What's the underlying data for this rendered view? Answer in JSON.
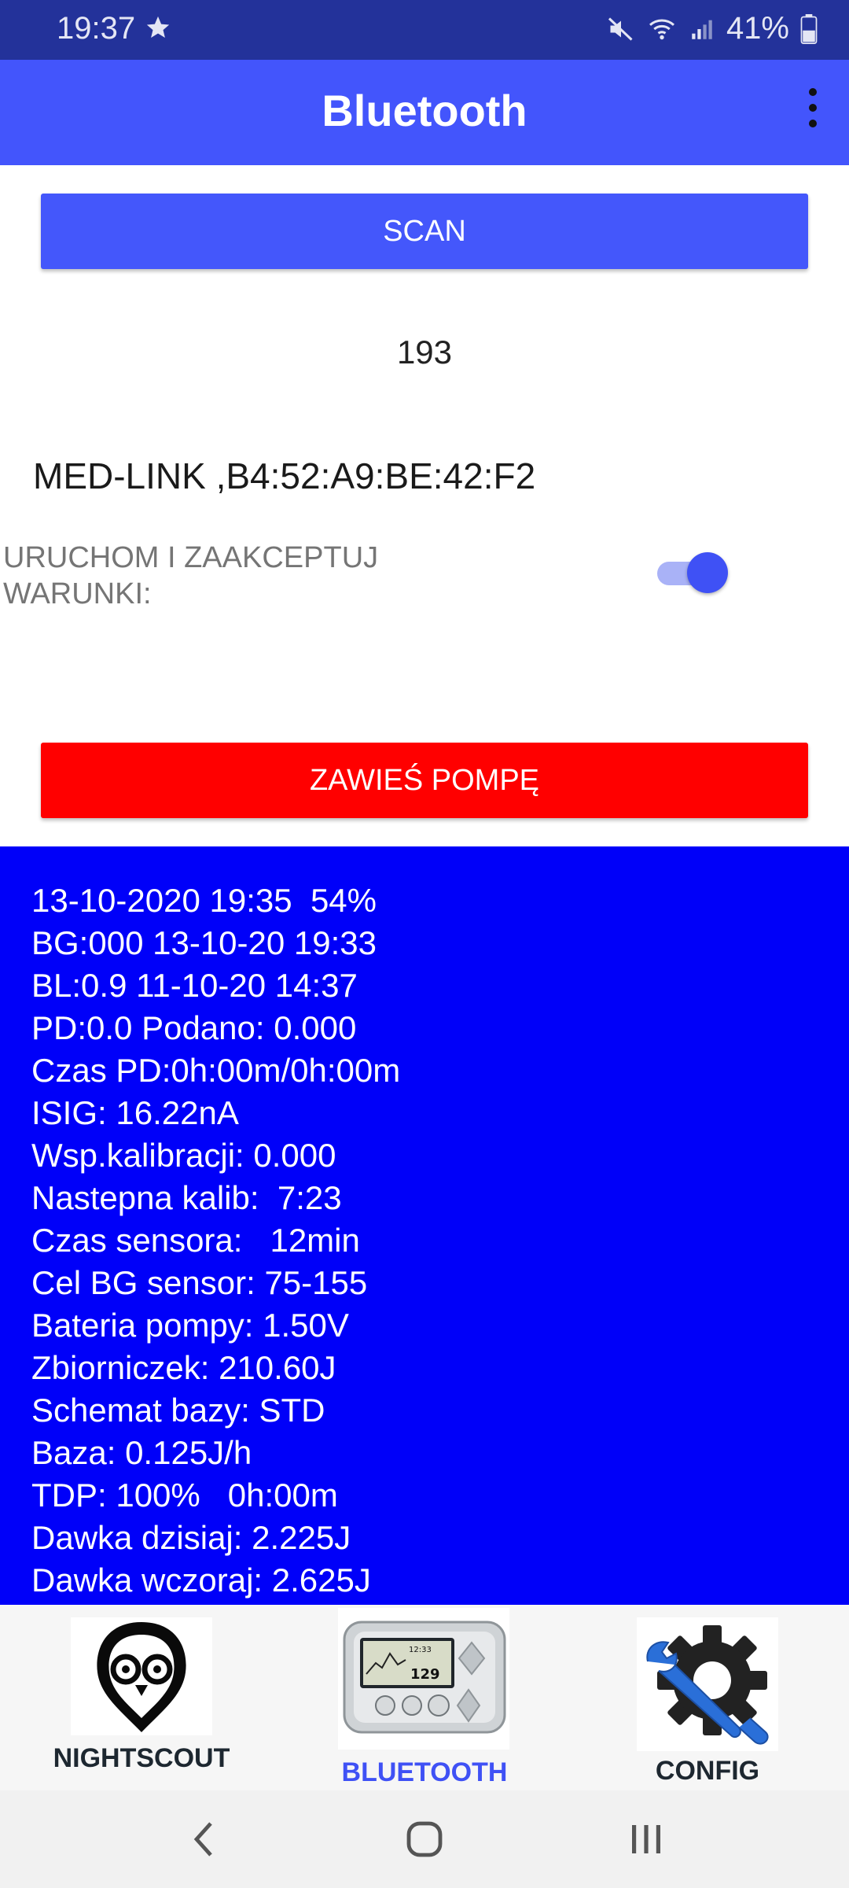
{
  "status_bar": {
    "time": "19:37",
    "battery_percent": "41%",
    "icons": [
      "star-icon",
      "mute-icon",
      "wifi-icon",
      "signal-icon",
      "battery-icon"
    ]
  },
  "app_bar": {
    "title": "Bluetooth",
    "menu_icon": "overflow-menu-icon",
    "background_color": "#4355fc"
  },
  "scan": {
    "label": "SCAN"
  },
  "scan_count": "193",
  "device": {
    "name": "MED-LINK ,B4:52:A9:BE:42:F2"
  },
  "accept_toggle": {
    "label": "URUCHOM I ZAAKCEPTUJ WARUNKI:",
    "checked": true
  },
  "suspend": {
    "label": "ZAWIEŚ POMPĘ",
    "color": "#ff0000"
  },
  "info": {
    "background_color": "#0000f9",
    "lines": [
      "13-10-2020 19:35  54%",
      "BG:000 13-10-20 19:33",
      "BL:0.9 11-10-20 14:37",
      "PD:0.0 Podano: 0.000",
      "Czas PD:0h:00m/0h:00m",
      "ISIG: 16.22nA",
      "Wsp.kalibracji: 0.000",
      "Nastepna kalib:  7:23",
      "Czas sensora:   12min",
      "Cel BG sensor: 75-155",
      "Bateria pompy: 1.50V",
      "Zbiorniczek: 210.60J",
      "Schemat bazy: STD",
      "Baza: 0.125J/h",
      "TDP: 100%   0h:00m",
      "Dawka dzisiaj: 2.225J",
      "Dawka wczoraj: 2.625J"
    ]
  },
  "bottom_nav": {
    "items": [
      {
        "label": "NIGHTSCOUT",
        "icon": "nightscout-owl-icon"
      },
      {
        "label": "BLUETOOTH",
        "icon": "insulin-pump-icon",
        "active": true
      },
      {
        "label": "CONFIG",
        "icon": "gear-wrench-icon"
      }
    ],
    "pump_screen": {
      "time": "12:33",
      "reading": "129"
    }
  },
  "system_nav": {
    "icons": [
      "back-icon",
      "home-icon",
      "recents-icon"
    ]
  }
}
